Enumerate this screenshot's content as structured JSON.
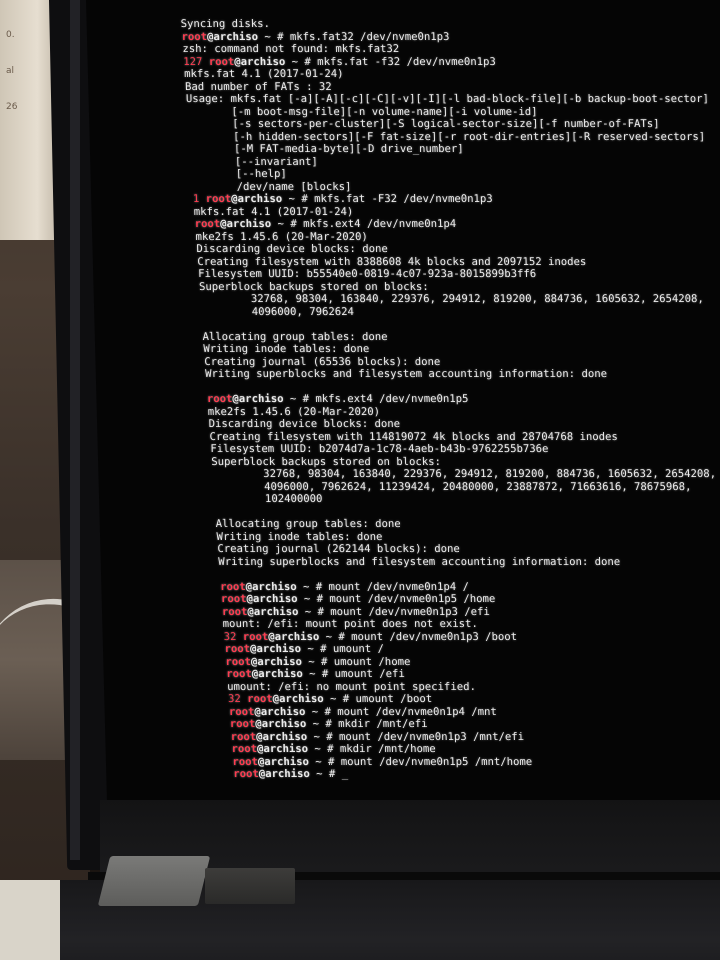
{
  "scene": {
    "paper_notes": [
      "0.",
      "al",
      "26"
    ]
  },
  "terminal": {
    "prompt": {
      "user": "root",
      "at": "@",
      "host": "archiso",
      "tail": " ~ # "
    },
    "colors": {
      "prompt_user": "#ff3c50",
      "text": "#ececec",
      "background": "#050505"
    },
    "lines": [
      {
        "type": "out",
        "text": "Syncing disks."
      },
      {
        "type": "cmd",
        "code": "",
        "cmd": "mkfs.fat32 /dev/nvme0n1p3"
      },
      {
        "type": "out",
        "text": "zsh: command not found: mkfs.fat32"
      },
      {
        "type": "cmd",
        "code": "127 ",
        "cmd": "mkfs.fat -f32 /dev/nvme0n1p3"
      },
      {
        "type": "out",
        "text": "mkfs.fat 4.1 (2017-01-24)"
      },
      {
        "type": "out",
        "text": "Bad number of FATs : 32"
      },
      {
        "type": "out",
        "text": "Usage: mkfs.fat [-a][-A][-c][-C][-v][-I][-l bad-block-file][-b backup-boot-sector]"
      },
      {
        "type": "out",
        "text": "       [-m boot-msg-file][-n volume-name][-i volume-id]"
      },
      {
        "type": "out",
        "text": "       [-s sectors-per-cluster][-S logical-sector-size][-f number-of-FATs]"
      },
      {
        "type": "out",
        "text": "       [-h hidden-sectors][-F fat-size][-r root-dir-entries][-R reserved-sectors]"
      },
      {
        "type": "out",
        "text": "       [-M FAT-media-byte][-D drive_number]"
      },
      {
        "type": "out",
        "text": "       [--invariant]"
      },
      {
        "type": "out",
        "text": "       [--help]"
      },
      {
        "type": "out",
        "text": "       /dev/name [blocks]"
      },
      {
        "type": "cmd",
        "code": "1 ",
        "cmd": "mkfs.fat -F32 /dev/nvme0n1p3"
      },
      {
        "type": "out",
        "text": "mkfs.fat 4.1 (2017-01-24)"
      },
      {
        "type": "cmd",
        "code": "",
        "cmd": "mkfs.ext4 /dev/nvme0n1p4"
      },
      {
        "type": "out",
        "text": "mke2fs 1.45.6 (20-Mar-2020)"
      },
      {
        "type": "out",
        "text": "Discarding device blocks: done"
      },
      {
        "type": "out",
        "text": "Creating filesystem with 8388608 4k blocks and 2097152 inodes"
      },
      {
        "type": "out",
        "text": "Filesystem UUID: b55540e0-0819-4c07-923a-8015899b3ff6"
      },
      {
        "type": "out",
        "text": "Superblock backups stored on blocks:"
      },
      {
        "type": "out",
        "text": "        32768, 98304, 163840, 229376, 294912, 819200, 884736, 1605632, 2654208,"
      },
      {
        "type": "out",
        "text": "        4096000, 7962624"
      },
      {
        "type": "out",
        "text": ""
      },
      {
        "type": "out",
        "text": "Allocating group tables: done"
      },
      {
        "type": "out",
        "text": "Writing inode tables: done"
      },
      {
        "type": "out",
        "text": "Creating journal (65536 blocks): done"
      },
      {
        "type": "out",
        "text": "Writing superblocks and filesystem accounting information: done"
      },
      {
        "type": "out",
        "text": ""
      },
      {
        "type": "cmd",
        "code": "",
        "cmd": "mkfs.ext4 /dev/nvme0n1p5"
      },
      {
        "type": "out",
        "text": "mke2fs 1.45.6 (20-Mar-2020)"
      },
      {
        "type": "out",
        "text": "Discarding device blocks: done"
      },
      {
        "type": "out",
        "text": "Creating filesystem with 114819072 4k blocks and 28704768 inodes"
      },
      {
        "type": "out",
        "text": "Filesystem UUID: b2074d7a-1c78-4aeb-b43b-9762255b736e"
      },
      {
        "type": "out",
        "text": "Superblock backups stored on blocks:"
      },
      {
        "type": "out",
        "text": "        32768, 98304, 163840, 229376, 294912, 819200, 884736, 1605632, 2654208,"
      },
      {
        "type": "out",
        "text": "        4096000, 7962624, 11239424, 20480000, 23887872, 71663616, 78675968,"
      },
      {
        "type": "out",
        "text": "        102400000"
      },
      {
        "type": "out",
        "text": ""
      },
      {
        "type": "out",
        "text": "Allocating group tables: done"
      },
      {
        "type": "out",
        "text": "Writing inode tables: done"
      },
      {
        "type": "out",
        "text": "Creating journal (262144 blocks): done"
      },
      {
        "type": "out",
        "text": "Writing superblocks and filesystem accounting information: done"
      },
      {
        "type": "out",
        "text": ""
      },
      {
        "type": "cmd",
        "code": "",
        "cmd": "mount /dev/nvme0n1p4 /"
      },
      {
        "type": "cmd",
        "code": "",
        "cmd": "mount /dev/nvme0n1p5 /home"
      },
      {
        "type": "cmd",
        "code": "",
        "cmd": "mount /dev/nvme0n1p3 /efi"
      },
      {
        "type": "out",
        "text": "mount: /efi: mount point does not exist."
      },
      {
        "type": "cmd",
        "code": "32 ",
        "cmd": "mount /dev/nvme0n1p3 /boot"
      },
      {
        "type": "cmd",
        "code": "",
        "cmd": "umount /"
      },
      {
        "type": "cmd",
        "code": "",
        "cmd": "umount /home"
      },
      {
        "type": "cmd",
        "code": "",
        "cmd": "umount /efi"
      },
      {
        "type": "out",
        "text": "umount: /efi: no mount point specified."
      },
      {
        "type": "cmd",
        "code": "32 ",
        "cmd": "umount /boot"
      },
      {
        "type": "cmd",
        "code": "",
        "cmd": "mount /dev/nvme0n1p4 /mnt"
      },
      {
        "type": "cmd",
        "code": "",
        "cmd": "mkdir /mnt/efi"
      },
      {
        "type": "cmd",
        "code": "",
        "cmd": "mount /dev/nvme0n1p3 /mnt/efi"
      },
      {
        "type": "cmd",
        "code": "",
        "cmd": "mkdir /mnt/home"
      },
      {
        "type": "cmd",
        "code": "",
        "cmd": "mount /dev/nvme0n1p5 /mnt/home"
      },
      {
        "type": "cmd",
        "code": "",
        "cmd": "_"
      }
    ]
  }
}
